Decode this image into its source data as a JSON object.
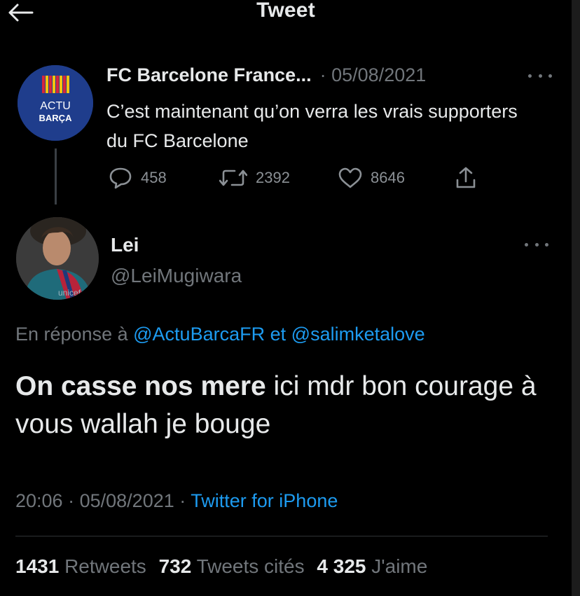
{
  "header": {
    "title": "Tweet",
    "back_icon": "arrow-left-icon"
  },
  "quoted_tweet": {
    "author_name": "FC Barcelone France...",
    "separator": "·",
    "date": "05/08/2021",
    "text": "C’est maintenant qu’on verra les vrais supporters du FC Barcelone",
    "avatar": {
      "line1": "ACTU",
      "line2": "BARÇA",
      "background": "#1f3d8c"
    },
    "actions": {
      "replies": "458",
      "retweets": "2392",
      "likes": "8646"
    }
  },
  "tweet": {
    "author_name": "Lei",
    "handle": "@LeiMugiwara",
    "avatar_caption": "unicef",
    "reply_prefix": "En réponse à",
    "reply_user1": "@ActuBarcaFR",
    "reply_conj": "et",
    "reply_user2": "@salimketalove",
    "text_bold": "On casse nos mere",
    "text_rest": " ici mdr bon courage à vous wallah je bouge",
    "time": "20:06",
    "meta_sep1": "·",
    "date": "05/08/2021",
    "meta_sep2": "·",
    "source": "Twitter for iPhone"
  },
  "stats": {
    "retweets_count": "1431",
    "retweets_label": "Retweets",
    "quotes_count": "732",
    "quotes_label": "Tweets cités",
    "likes_count": "4 325",
    "likes_label": "J'aime"
  },
  "colors": {
    "background": "#000000",
    "text": "#e7e9ea",
    "secondary": "#71767b",
    "link": "#1d9bf0"
  }
}
